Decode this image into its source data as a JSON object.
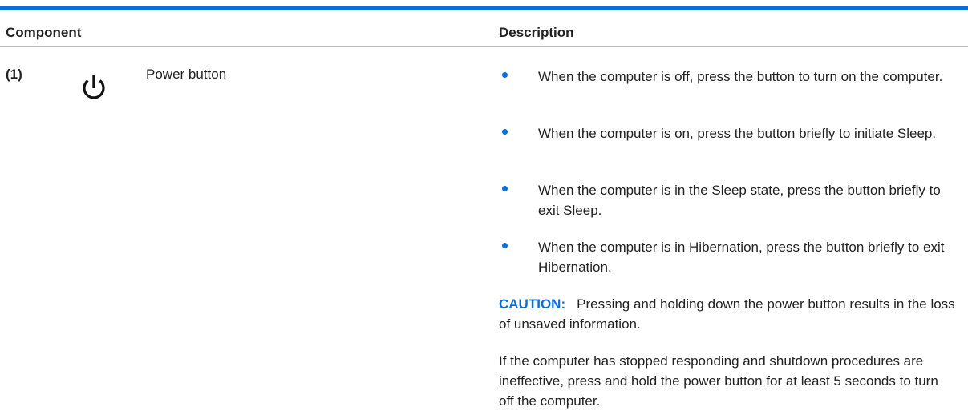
{
  "table": {
    "headers": {
      "component": "Component",
      "description": "Description"
    },
    "rows": [
      {
        "number": "(1)",
        "icon": "power-icon",
        "component": "Power button",
        "bullets": [
          "When the computer is off, press the button to turn on the computer.",
          "When the computer is on, press the button briefly to initiate Sleep.",
          "When the computer is in the Sleep state, press the button briefly to exit Sleep.",
          "When the computer is in Hibernation, press the button briefly to exit Hibernation."
        ],
        "caution": {
          "label": "CAUTION:",
          "text": "Pressing and holding down the power button results in the loss of unsaved information."
        },
        "note": "If the computer has stopped responding and shutdown procedures are ineffective, press and hold the power button for at least 5 seconds to turn off the computer."
      }
    ]
  },
  "colors": {
    "accent": "#0a6ed8",
    "text": "#222222",
    "rule": "#bdbdbd"
  }
}
